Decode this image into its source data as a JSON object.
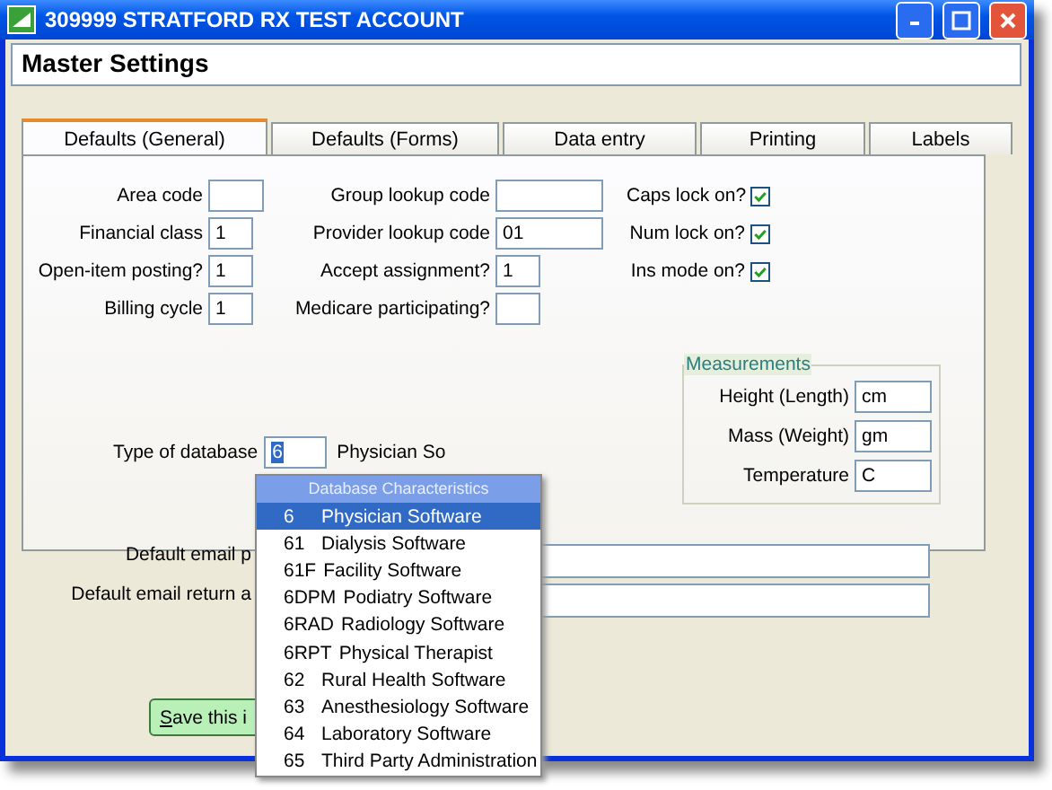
{
  "window": {
    "title": "309999 STRATFORD RX TEST ACCOUNT"
  },
  "header": "Master Settings",
  "tabs": [
    {
      "label": "Defaults (General)",
      "selected": true
    },
    {
      "label": "Defaults (Forms)",
      "selected": false
    },
    {
      "label": "Data entry",
      "selected": false
    },
    {
      "label": "Printing",
      "selected": false
    },
    {
      "label": "Labels",
      "selected": false
    }
  ],
  "left_fields": [
    {
      "label": "Area code"
    },
    {
      "label": "Financial class",
      "value": "1"
    },
    {
      "label": "Open-item posting?",
      "value": "1"
    },
    {
      "label": "Billing cycle",
      "value": "1"
    }
  ],
  "middle_fields": [
    {
      "label": "Group lookup code"
    },
    {
      "label": "Provider lookup code",
      "value": "01"
    },
    {
      "label": "Accept assignment?",
      "value": "1"
    },
    {
      "label": "Medicare participating?"
    }
  ],
  "checks": [
    {
      "label": "Caps lock on?",
      "checked": true
    },
    {
      "label": "Num lock on?",
      "checked": true
    },
    {
      "label": "Ins mode on?",
      "checked": true
    }
  ],
  "measurements": {
    "title": "Measurements",
    "fields": [
      {
        "label": "Height (Length)",
        "value": "cm"
      },
      {
        "label": "Mass (Weight)",
        "value": "gm"
      },
      {
        "label": "Temperature",
        "value": "C"
      }
    ]
  },
  "database": {
    "label": "Type of database",
    "value": "6",
    "description": "Physician So"
  },
  "email_fields": [
    {
      "label": "Default email p"
    },
    {
      "label": "Default email return a"
    }
  ],
  "save_button": {
    "label": "Save this i"
  },
  "dropdown": {
    "title": "Database Characteristics",
    "items": [
      {
        "code": "6",
        "name": "Physician Software",
        "selected": true
      },
      {
        "code": "61",
        "name": "Dialysis Software",
        "selected": false
      },
      {
        "code": "61F",
        "name": "Facility Software",
        "selected": false
      },
      {
        "code": "6DPM",
        "name": "Podiatry Software",
        "selected": false
      },
      {
        "code": "6RAD",
        "name": "Radiology Software",
        "selected": false
      },
      {
        "code": "6RPT",
        "name": "Physical Therapist",
        "selected": false
      },
      {
        "code": "62",
        "name": "Rural Health Software",
        "selected": false
      },
      {
        "code": "63",
        "name": "Anesthesiology Software",
        "selected": false
      },
      {
        "code": "64",
        "name": "Laboratory Software",
        "selected": false
      },
      {
        "code": "65",
        "name": "Third Party Administration",
        "selected": false
      }
    ]
  }
}
